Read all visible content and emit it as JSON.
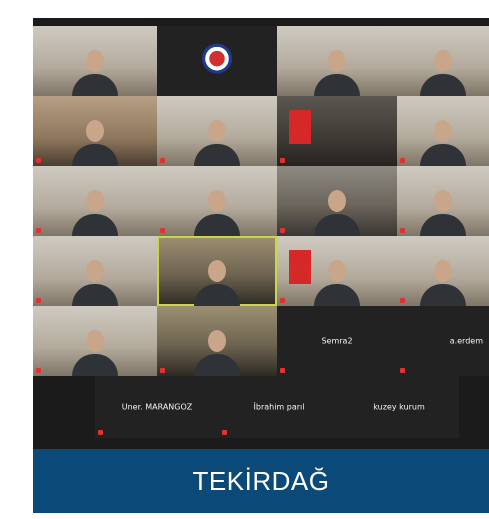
{
  "caption": "TEKİRDAĞ",
  "grid": {
    "row1": [
      "",
      "",
      "",
      ""
    ],
    "row2": [
      "",
      "",
      "",
      ""
    ],
    "row3": [
      "",
      "",
      "",
      ""
    ],
    "row4": [
      "",
      "",
      "",
      ""
    ],
    "row5": [
      "",
      "",
      "Semra2",
      "a.erdem"
    ],
    "row6": [
      "Uner. MARANGOZ",
      "İbrahim parıl",
      "kuzey kurum"
    ]
  },
  "colors": {
    "caption_bg": "#0b4a78",
    "active_speaker": "#c9d64a",
    "muted_icon": "#e03232"
  },
  "icons": [
    "organization-logo-icon",
    "muted-microphone-icon"
  ]
}
